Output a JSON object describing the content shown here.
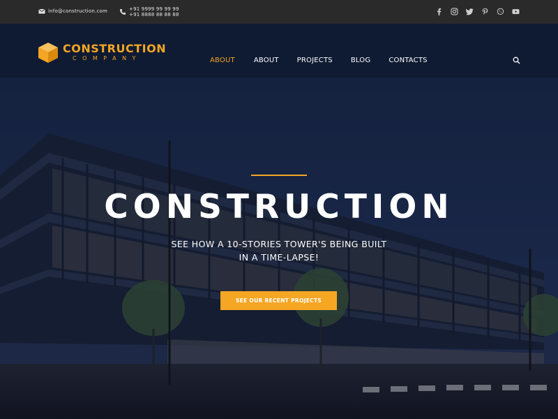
{
  "topbar": {
    "email": "info@construction.com",
    "phones": [
      "+91 9999 99 99 99",
      "+91 8888 88 88 88"
    ],
    "social_icons": [
      "facebook-icon",
      "instagram-icon",
      "twitter-icon",
      "pinterest-icon",
      "whatsapp-icon",
      "youtube-icon"
    ]
  },
  "header": {
    "logo_main": "CONSTRUCTION",
    "logo_sub": "COMPANY",
    "nav": [
      "ABOUT",
      "ABOUT",
      "PROJECTS",
      "BLOG",
      "CONTACTS"
    ],
    "active_nav": 0
  },
  "hero": {
    "title": "CONSTRUCTION",
    "subtitle_line1": "SEE HOW A 10-STORIES TOWER'S BEING BUILT",
    "subtitle_line2": "IN A TIME-LAPSE!",
    "cta_label": "SEE OUR RECENT PROJECTS"
  },
  "colors": {
    "accent": "#f5a623",
    "topbar_bg": "#2a2a2a",
    "header_bg": "#0f1b33"
  }
}
